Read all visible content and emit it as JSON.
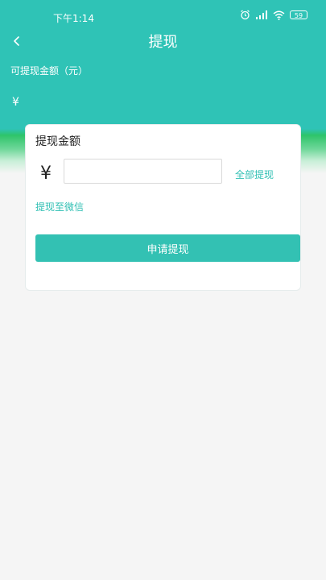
{
  "status_bar": {
    "time": "下午1:14",
    "battery": "59",
    "icons": [
      "alarm-icon",
      "signal-icon",
      "wifi-icon",
      "battery-icon"
    ]
  },
  "nav": {
    "back_icon": "chevron-left-icon",
    "title": "提现"
  },
  "balance": {
    "label": "可提现金额（元）",
    "value": "¥"
  },
  "card": {
    "title": "提现金额",
    "currency_symbol": "¥",
    "amount_value": "",
    "amount_placeholder": "",
    "withdraw_all_label": "全部提现",
    "method_label": "提现至微信",
    "submit_label": "申请提现"
  },
  "colors": {
    "primary": "#2fc3b6",
    "accent_green": "#2ec46a",
    "background": "#f5f5f5"
  }
}
